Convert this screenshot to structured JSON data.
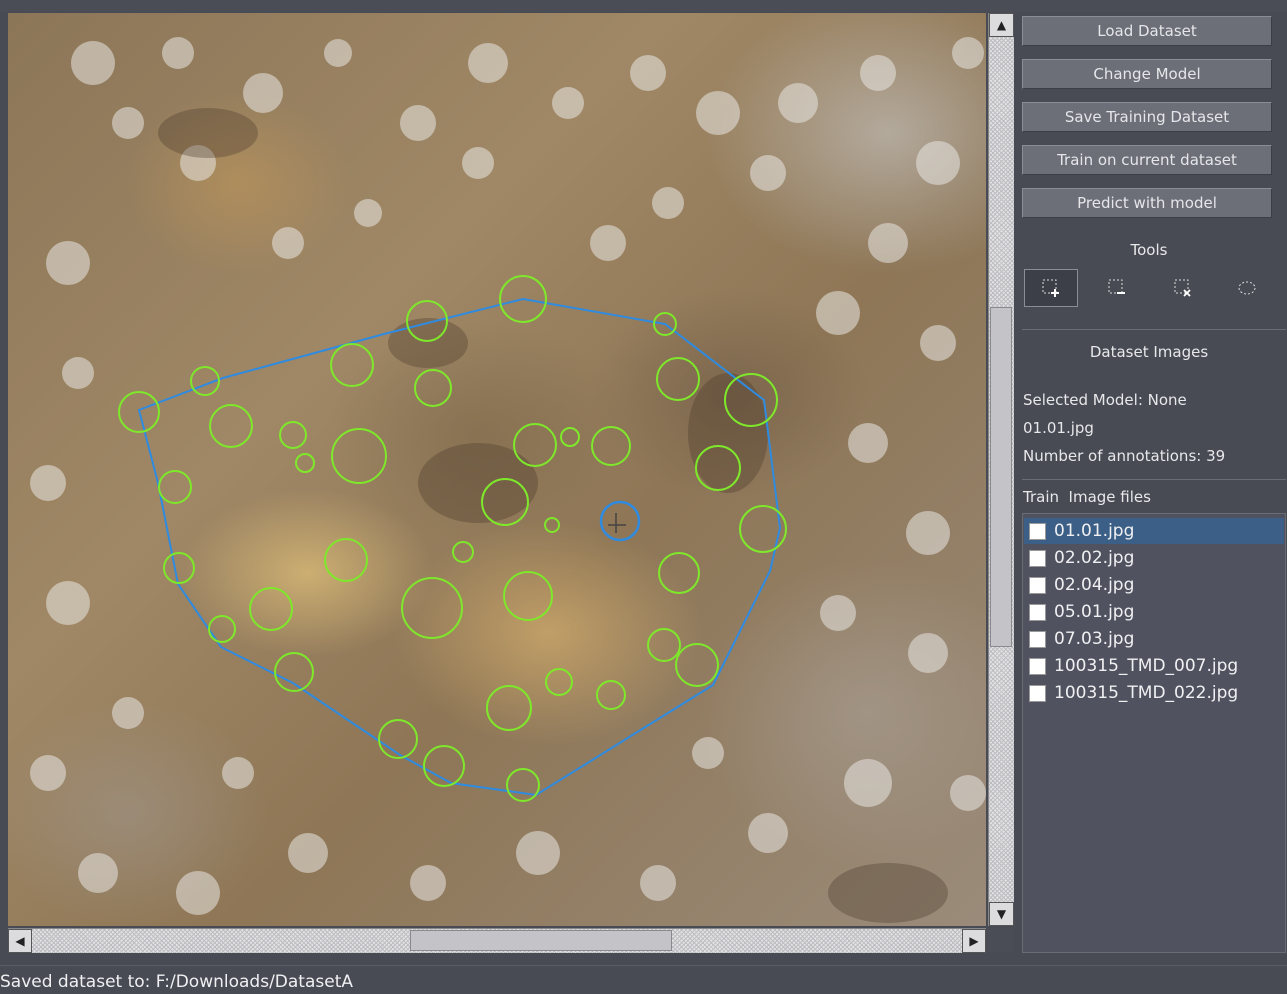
{
  "toolbar": {
    "load_dataset": "Load Dataset",
    "change_model": "Change Model",
    "save_training_dataset": "Save Training Dataset",
    "train_on_current": "Train on current dataset",
    "predict_with_model": "Predict with model"
  },
  "tools": {
    "heading": "Tools",
    "items": [
      {
        "icon": "add-selection-icon",
        "active": true
      },
      {
        "icon": "remove-selection-icon",
        "active": false
      },
      {
        "icon": "delete-selection-icon",
        "active": false
      },
      {
        "icon": "ellipse-icon",
        "active": false
      }
    ]
  },
  "dataset": {
    "heading": "Dataset Images",
    "selected_model": "Selected Model: None",
    "current_file": "01.01.jpg",
    "annotations": "Number of annotations: 39",
    "list_heading": "Train  Image files",
    "files": [
      {
        "name": "01.01.jpg",
        "selected": true
      },
      {
        "name": "02.02.jpg",
        "selected": false
      },
      {
        "name": "02.04.jpg",
        "selected": false
      },
      {
        "name": "05.01.jpg",
        "selected": false
      },
      {
        "name": "07.03.jpg",
        "selected": false
      },
      {
        "name": "100315_TMD_007.jpg",
        "selected": false
      },
      {
        "name": "100315_TMD_022.jpg",
        "selected": false
      }
    ]
  },
  "status": {
    "message": "Saved dataset to: F:/Downloads/DatasetA"
  },
  "colors": {
    "annotation": "#7ee82a",
    "region": "#2f8be0",
    "selection": "#3b5f86"
  }
}
